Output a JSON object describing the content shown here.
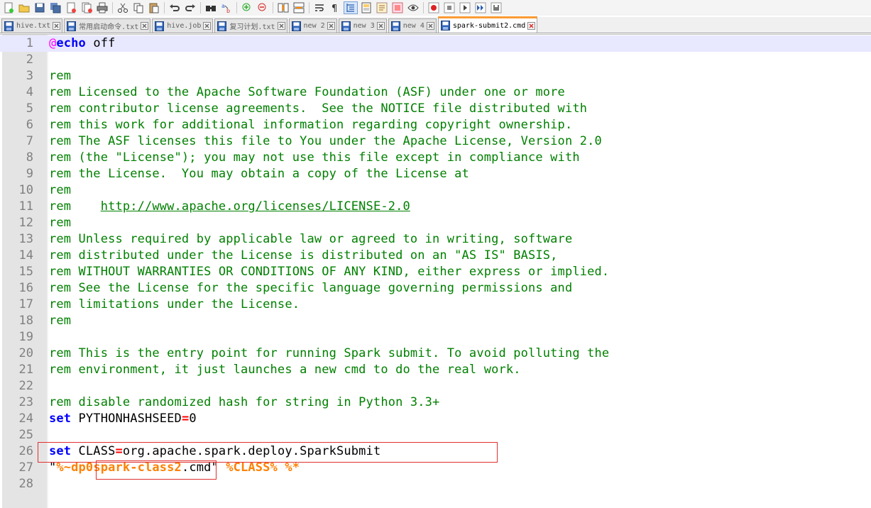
{
  "toolbar": {
    "buttons": [
      "new-file-icon",
      "open-file-icon",
      "save-icon",
      "save-all-icon",
      "close-icon",
      "close-all-icon",
      "print-icon",
      "cut-icon",
      "copy-icon",
      "paste-icon",
      "undo-icon",
      "redo-icon",
      "find-icon",
      "replace-icon",
      "zoom-in-icon",
      "zoom-out-icon",
      "sync-vertical-icon",
      "sync-horizontal-icon",
      "word-wrap-icon",
      "show-all-characters-icon",
      "indent-guide-icon",
      "document-map-icon",
      "function-list-icon",
      "folder-workspace-icon",
      "monitoring-eye-icon",
      "record-macro-icon",
      "stop-macro-icon",
      "play-macro-icon",
      "run-macro-multiple-icon",
      "save-macro-icon"
    ],
    "active_button": "indent-guide-icon"
  },
  "tabs": [
    {
      "label": "hive.txt",
      "active": false
    },
    {
      "label": "常用启动命令.txt",
      "active": false
    },
    {
      "label": "hive.job",
      "active": false
    },
    {
      "label": "复习计划.txt",
      "active": false
    },
    {
      "label": "new 2",
      "active": false
    },
    {
      "label": "new 3",
      "active": false
    },
    {
      "label": "new 4",
      "active": false
    },
    {
      "label": "spark-submit2.cmd",
      "active": true
    }
  ],
  "editor": {
    "current_line": 1,
    "lines": [
      {
        "n": "1",
        "parts": [
          {
            "t": "@",
            "c": "at"
          },
          {
            "t": "echo",
            "c": "kw"
          },
          {
            "t": " off",
            "c": ""
          }
        ]
      },
      {
        "n": "2",
        "parts": []
      },
      {
        "n": "3",
        "parts": [
          {
            "t": "rem",
            "c": "cmt"
          }
        ]
      },
      {
        "n": "4",
        "parts": [
          {
            "t": "rem Licensed to the Apache Software Foundation (ASF) under one or more",
            "c": "cmt"
          }
        ]
      },
      {
        "n": "5",
        "parts": [
          {
            "t": "rem contributor license agreements.  See the NOTICE file distributed with",
            "c": "cmt"
          }
        ]
      },
      {
        "n": "6",
        "parts": [
          {
            "t": "rem this work for additional information regarding copyright ownership.",
            "c": "cmt"
          }
        ]
      },
      {
        "n": "7",
        "parts": [
          {
            "t": "rem The ASF licenses this file to You under the Apache License, Version 2.0",
            "c": "cmt"
          }
        ]
      },
      {
        "n": "8",
        "parts": [
          {
            "t": "rem (the \"License\"); you may not use this file except in compliance with",
            "c": "cmt"
          }
        ]
      },
      {
        "n": "9",
        "parts": [
          {
            "t": "rem the License.  You may obtain a copy of the License at",
            "c": "cmt"
          }
        ]
      },
      {
        "n": "10",
        "parts": [
          {
            "t": "rem",
            "c": "cmt"
          }
        ]
      },
      {
        "n": "11",
        "parts": [
          {
            "t": "rem    ",
            "c": "cmt"
          },
          {
            "t": "http://www.apache.org/licenses/LICENSE-2.0",
            "c": "url"
          }
        ]
      },
      {
        "n": "12",
        "parts": [
          {
            "t": "rem",
            "c": "cmt"
          }
        ]
      },
      {
        "n": "13",
        "parts": [
          {
            "t": "rem Unless required by applicable law or agreed to in writing, software",
            "c": "cmt"
          }
        ]
      },
      {
        "n": "14",
        "parts": [
          {
            "t": "rem distributed under the License is distributed on an \"AS IS\" BASIS,",
            "c": "cmt"
          }
        ]
      },
      {
        "n": "15",
        "parts": [
          {
            "t": "rem WITHOUT WARRANTIES OR CONDITIONS OF ANY KIND, either express or implied.",
            "c": "cmt"
          }
        ]
      },
      {
        "n": "16",
        "parts": [
          {
            "t": "rem See the License for the specific language governing permissions and",
            "c": "cmt"
          }
        ]
      },
      {
        "n": "17",
        "parts": [
          {
            "t": "rem limitations under the License.",
            "c": "cmt"
          }
        ]
      },
      {
        "n": "18",
        "parts": [
          {
            "t": "rem",
            "c": "cmt"
          }
        ]
      },
      {
        "n": "19",
        "parts": []
      },
      {
        "n": "20",
        "parts": [
          {
            "t": "rem This is the entry point for running Spark submit. To avoid polluting the",
            "c": "cmt"
          }
        ]
      },
      {
        "n": "21",
        "parts": [
          {
            "t": "rem environment, it just launches a new cmd to do the real work.",
            "c": "cmt"
          }
        ]
      },
      {
        "n": "22",
        "parts": []
      },
      {
        "n": "23",
        "parts": [
          {
            "t": "rem disable randomized hash for string in Python 3.3+",
            "c": "cmt"
          }
        ]
      },
      {
        "n": "24",
        "parts": [
          {
            "t": "set",
            "c": "kw"
          },
          {
            "t": " PYTHONHASHSEED",
            "c": ""
          },
          {
            "t": "=",
            "c": "op"
          },
          {
            "t": "0",
            "c": ""
          }
        ]
      },
      {
        "n": "25",
        "parts": []
      },
      {
        "n": "26",
        "parts": [
          {
            "t": "set",
            "c": "kw"
          },
          {
            "t": " CLASS",
            "c": ""
          },
          {
            "t": "=",
            "c": "op"
          },
          {
            "t": "org.apache.spark.deploy.SparkSubmit",
            "c": ""
          }
        ]
      },
      {
        "n": "27",
        "parts": [
          {
            "t": "\"",
            "c": ""
          },
          {
            "t": "%~dp0spark-class2",
            "c": "var"
          },
          {
            "t": ".cmd\" ",
            "c": ""
          },
          {
            "t": "%CLASS%",
            "c": "var"
          },
          {
            "t": " ",
            "c": ""
          },
          {
            "t": "%*",
            "c": "var"
          }
        ]
      },
      {
        "n": "28",
        "parts": []
      }
    ]
  },
  "colors": {
    "keyword": "#0000ff",
    "comment": "#008000",
    "variable": "#ff8000",
    "operator": "#ff0000",
    "annotation_box": "#e03030",
    "active_tab_accent": "#fa9a33"
  }
}
